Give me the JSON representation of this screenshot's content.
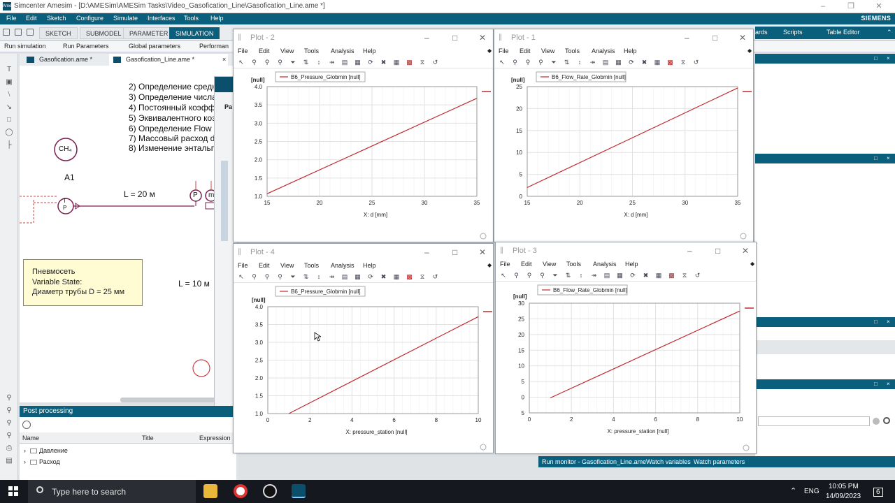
{
  "window": {
    "title": "Simcenter Amesim - [D:\\AMESim\\AMESim Tasks\\Video_Gasofication_Line\\Gasofication_Line.ame *]",
    "brand": "SIEMENS"
  },
  "menu": [
    "File",
    "Edit",
    "Sketch",
    "Configure",
    "Simulate",
    "Interfaces",
    "Tools",
    "Help"
  ],
  "ribbon_tabs": [
    "SKETCH",
    "SUBMODEL",
    "PARAMETER",
    "SIMULATION"
  ],
  "ribbon_right": {
    "ards": "ards",
    "scripts": "Scripts",
    "table_editor": "Table Editor"
  },
  "sim_toolbar": [
    "Run simulation",
    "Run Parameters",
    "Global parameters",
    "Performan"
  ],
  "doc_tabs": [
    "Gasofication.ame *",
    "Gasofication_Line.ame *"
  ],
  "sketch": {
    "lines": [
      "2) Определение средн",
      "3) Определение числа",
      "4) Постоянный коэфф",
      "5) Эквивалентного коэ",
      "6) Определение Flow R",
      "7) Массовый расход dr",
      "8) Изменение энтальп"
    ],
    "ch4": "CH₄",
    "a1": "A1",
    "len1": "L = 20 м",
    "len2": "L = 10 м",
    "tp_top": "T",
    "tp_bot": "P",
    "p_label": "P",
    "m_label": "m",
    "note": [
      "Пневмосеть",
      "Variable State:",
      "Диаметр трубы D = 25 мм"
    ]
  },
  "dialog_labels": {
    "title_letter": "Pa"
  },
  "postproc": {
    "title": "Post processing",
    "columns": [
      "Name",
      "Title",
      "Expression"
    ],
    "items": [
      "Давление",
      "Расход"
    ]
  },
  "plot_menu": [
    "File",
    "Edit",
    "View",
    "Tools",
    "Analysis",
    "Help"
  ],
  "plots": [
    {
      "title": "Plot - 2",
      "legend": "B6_Pressure_Globmin [null]",
      "ylabel": "[null]",
      "xlabel": "X: d [mm]"
    },
    {
      "title": "Plot - 1",
      "legend": "B6_Flow_Rate_Globmin [null]",
      "ylabel": "[null]",
      "xlabel": "X: d [mm]"
    },
    {
      "title": "Plot - 4",
      "legend": "B6_Pressure_Globmin [null]",
      "ylabel": "[null]",
      "xlabel": "X: pressure_station [null]"
    },
    {
      "title": "Plot - 3",
      "legend": "B6_Flow_Rate_Globmin [null]",
      "ylabel": "[null]",
      "xlabel": "X: pressure_station [null]"
    }
  ],
  "chart_data": [
    {
      "type": "line",
      "xlim": [
        15,
        35
      ],
      "ylim": [
        1.0,
        4.0
      ],
      "xticks": [
        "15",
        "20",
        "25",
        "30",
        "35"
      ],
      "yticks": [
        "1.0",
        "1.5",
        "2.0",
        "2.5",
        "3.0",
        "3.5",
        "4.0"
      ],
      "series": [
        {
          "name": "B6_Pressure_Globmin [null]",
          "x": [
            15,
            35
          ],
          "y": [
            1.07,
            3.68
          ]
        }
      ],
      "grid": true,
      "legend": "top-left",
      "color": "#c0282d"
    },
    {
      "type": "line",
      "xlim": [
        15,
        35
      ],
      "ylim": [
        0,
        25
      ],
      "xticks": [
        "15",
        "20",
        "25",
        "30",
        "35"
      ],
      "yticks": [
        "0",
        "5",
        "10",
        "15",
        "20",
        "25"
      ],
      "series": [
        {
          "name": "B6_Flow_Rate_Globmin [null]",
          "x": [
            15,
            35
          ],
          "y": [
            2.0,
            24.7
          ]
        }
      ],
      "grid": true,
      "legend": "top-left",
      "color": "#c0282d"
    },
    {
      "type": "line",
      "xlim": [
        0,
        10
      ],
      "ylim": [
        1.0,
        4.0
      ],
      "xticks": [
        "0",
        "2",
        "4",
        "6",
        "8",
        "10"
      ],
      "yticks": [
        "1.0",
        "1.5",
        "2.0",
        "2.5",
        "3.0",
        "3.5",
        "4.0"
      ],
      "series": [
        {
          "name": "B6_Pressure_Globmin [null]",
          "x": [
            1,
            10
          ],
          "y": [
            1.0,
            3.72
          ]
        }
      ],
      "grid": true,
      "legend": "top-left",
      "color": "#c0282d"
    },
    {
      "type": "line",
      "xlim": [
        0,
        10
      ],
      "ylim": [
        -5,
        30
      ],
      "xticks": [
        "0",
        "2",
        "4",
        "6",
        "8",
        "10"
      ],
      "yticks": [
        "5",
        "0",
        "5",
        "10",
        "15",
        "20",
        "25",
        "30"
      ],
      "series": [
        {
          "name": "B6_Flow_Rate_Globmin [null]",
          "x": [
            1,
            10
          ],
          "y": [
            -0.2,
            27.5
          ]
        }
      ],
      "grid": true,
      "legend": "top-left",
      "color": "#c0282d"
    }
  ],
  "right_panel": {
    "bottom_tabs": [
      "Run monitor - Gasofication_Line.ame",
      "Watch variables",
      "Watch parameters"
    ]
  },
  "taskbar": {
    "search": "Type here to search",
    "lang": "ENG",
    "time": "10:05 PM",
    "date": "14/09/2023",
    "notif": "6"
  }
}
